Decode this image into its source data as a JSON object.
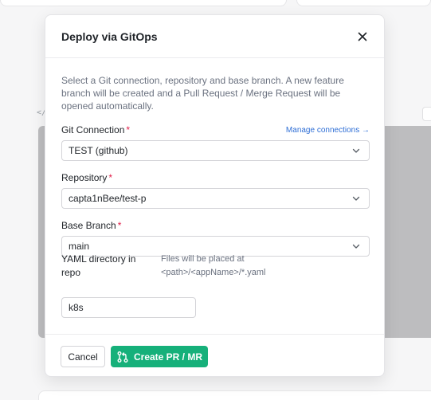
{
  "background": {
    "code_tag": "</"
  },
  "modal": {
    "title": "Deploy via GitOps",
    "intro": "Select a Git connection, repository and base branch. A new feature branch will be created and a Pull Request / Merge Request will be opened automatically.",
    "required_mark": "*",
    "git_connection": {
      "label": "Git Connection",
      "manage_link": "Manage connections →",
      "selected": "TEST (github)"
    },
    "repository": {
      "label": "Repository",
      "selected": "capta1nBee/test-p"
    },
    "base_branch": {
      "label": "Base Branch",
      "selected": "main"
    },
    "yaml_directory": {
      "label": "YAML directory in repo",
      "hint": "Files will be placed at <path>/<appName>/*.yaml",
      "value": "k8s"
    },
    "footer": {
      "cancel_label": "Cancel",
      "create_label": "Create PR / MR"
    }
  },
  "colors": {
    "primary": "#16b07a",
    "link": "#2f6fd6",
    "required": "#e11d48"
  },
  "icons": {
    "close": "close-icon",
    "chevron": "chevron-down-icon",
    "pull_request": "git-pull-request-icon"
  }
}
